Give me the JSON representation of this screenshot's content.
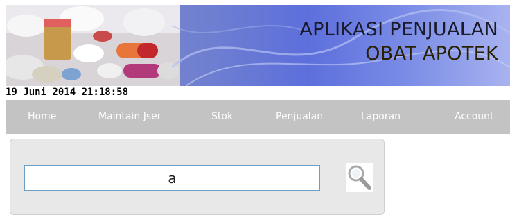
{
  "header": {
    "title_line1": "APLIKASI PENJUALAN",
    "title_line2": "OBAT APOTEK"
  },
  "datetime": "19 Juni 2014 21:18:58",
  "nav": {
    "items": [
      {
        "label": "Home"
      },
      {
        "label": "Maintain Jser"
      },
      {
        "label": "Stok"
      },
      {
        "label": "Penjualan"
      },
      {
        "label": "Laporan"
      },
      {
        "label": "Account"
      }
    ]
  },
  "search": {
    "value": "a",
    "icon": "magnifier-icon"
  },
  "colors": {
    "navbar": "#c3c3c3",
    "nav_text": "#ffffff",
    "panel": "#e8e8e8",
    "input_border": "#6aa0c8"
  }
}
